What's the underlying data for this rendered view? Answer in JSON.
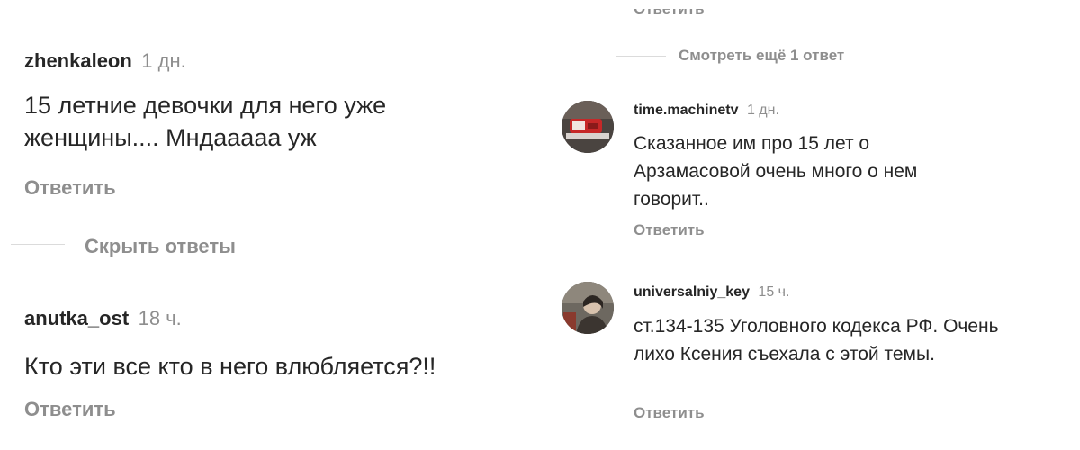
{
  "left": {
    "comments": [
      {
        "username": "zhenkaleon",
        "time": "1 дн.",
        "text": "15 летние девочки для него уже женщины.... Мндааааа уж",
        "reply_label": "Ответить"
      },
      {
        "username": "anutka_ost",
        "time": "18 ч.",
        "text": "Кто эти все кто в него влюбляется?!!",
        "reply_label": "Ответить"
      }
    ],
    "hide_replies_label": "Скрыть ответы"
  },
  "right": {
    "top_reply_label": "Ответить",
    "view_more_label": "Смотреть ещё 1 ответ",
    "comments": [
      {
        "username": "time.machinetv",
        "time": "1 дн.",
        "text": "Сказанное им про 15 лет о Арзамасовой очень много о нем говорит..",
        "reply_label": "Ответить",
        "avatar_icon": "red-device-avatar-icon"
      },
      {
        "username": "universalniy_key",
        "time": "15 ч.",
        "text": "ст.134-135 Уголовного кодекса РФ. Очень лихо Ксения съехала с этой темы.",
        "reply_label": "Ответить",
        "avatar_icon": "person-photo-avatar-icon"
      }
    ]
  }
}
